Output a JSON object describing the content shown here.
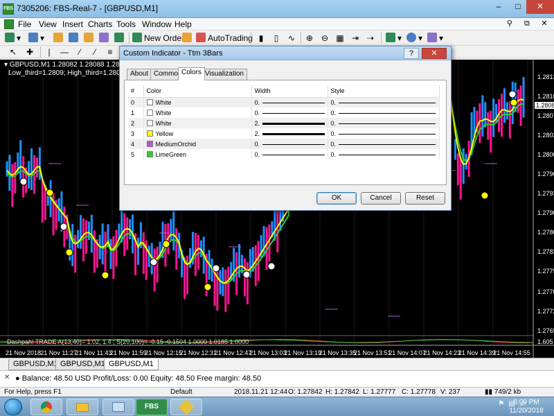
{
  "window": {
    "title": "7305206: FBS-Real-7 - [GBPUSD,M1]",
    "app_icon": "FBS",
    "min": "–",
    "max": "□",
    "close": "✕"
  },
  "menu": {
    "items": [
      "File",
      "View",
      "Insert",
      "Charts",
      "Tools",
      "Window",
      "Help"
    ],
    "right_icons": [
      "search-icon",
      "restore-icon",
      "close-icon"
    ]
  },
  "toolbar": {
    "new_order": "New Order",
    "autotrading": "AutoTrading",
    "icon_colors": [
      "#2e8b57",
      "#4a7fc1",
      "#e8a33a",
      "#d9534f",
      "#8b6fc9"
    ]
  },
  "chart": {
    "symbol_header": "GBPUSD,M1  1.28082 1.28088 1.28081 1.28088",
    "indicator_line": "Low_third=1.2809; High_third=1.2809",
    "price_ticks": [
      "1.28133",
      "1.28105",
      "1.28088",
      "1.28074",
      "1.28039",
      "1.28004",
      "1.27969",
      "1.27935",
      "1.27900",
      "1.27865",
      "1.27830",
      "1.27795",
      "1.27760",
      "1.27725",
      "1.27690",
      "1.605"
    ],
    "current_price": "1.28088",
    "time_ticks": [
      "21 Nov 2018",
      "21 Nov 11:27",
      "21 Nov 11:43",
      "21 Nov 11:59",
      "21 Nov 12:15",
      "21 Nov 12:31",
      "21 Nov 12:47",
      "21 Nov 13:03",
      "21 Nov 13:19",
      "21 Nov 13:35",
      "21 Nov 13:51",
      "21 Nov 14:07",
      "21 Nov 14:23",
      "21 Nov 14:39",
      "21 Nov 14:55"
    ],
    "sub_indicator_label": "Dashpah! TRADE  A(13,40)= 1.02, 1.4 ; S(20,100)= -0.15  -0.1504  1.0000  1.0185  1.0000",
    "colors": {
      "up": "#1e90ff",
      "down": "#ff1493",
      "yellow": "#ffff00",
      "lime": "#32cd32",
      "white": "#ffffff",
      "orchid": "#ba55d3"
    }
  },
  "chart_tabs": [
    {
      "label": "GBPUSD,M1",
      "active": false
    },
    {
      "label": "GBPUSD,M1",
      "active": false
    },
    {
      "label": "GBPUSD,M1",
      "active": true
    }
  ],
  "terminal": {
    "balance_line": "Balance: 48.50 USD  Profit/Loss: 0.00  Equity: 48.50  Free margin: 48.50"
  },
  "status": {
    "help": "For Help, press F1",
    "profile": "Default",
    "datetime": "2018.11.21 12:44",
    "open": "O: 1.27842",
    "high": "H: 1.27842",
    "low": "L: 1.27777",
    "close": "C: 1.27778",
    "volume": "V: 237",
    "connection": "749/2 kb"
  },
  "taskbar": {
    "apps": [
      "FBS"
    ],
    "time": "6:09 PM",
    "date": "11/20/2018"
  },
  "dialog": {
    "title": "Custom Indicator - Ttm 3Bars",
    "help": "?",
    "close": "✕",
    "tabs": [
      {
        "label": "About",
        "active": false
      },
      {
        "label": "Common",
        "active": false
      },
      {
        "label": "Colors",
        "active": true
      },
      {
        "label": "Visualization",
        "active": false
      }
    ],
    "columns": [
      "#",
      "Color",
      "Width",
      "Style"
    ],
    "rows": [
      {
        "index": "0",
        "color_name": "White",
        "color": "#ffffff",
        "width": "0.",
        "style": "0."
      },
      {
        "index": "1",
        "color_name": "White",
        "color": "#ffffff",
        "width": "0.",
        "style": "0."
      },
      {
        "index": "2",
        "color_name": "White",
        "color": "#ffffff",
        "width": "2.",
        "style": "0."
      },
      {
        "index": "3",
        "color_name": "Yellow",
        "color": "#ffff00",
        "width": "2.",
        "style": "0."
      },
      {
        "index": "4",
        "color_name": "MediumOrchid",
        "color": "#ba55d3",
        "width": "0.",
        "style": "0."
      },
      {
        "index": "5",
        "color_name": "LimeGreen",
        "color": "#32cd32",
        "width": "0.",
        "style": "0."
      }
    ],
    "ok": "OK",
    "cancel": "Cancel",
    "reset": "Reset"
  }
}
